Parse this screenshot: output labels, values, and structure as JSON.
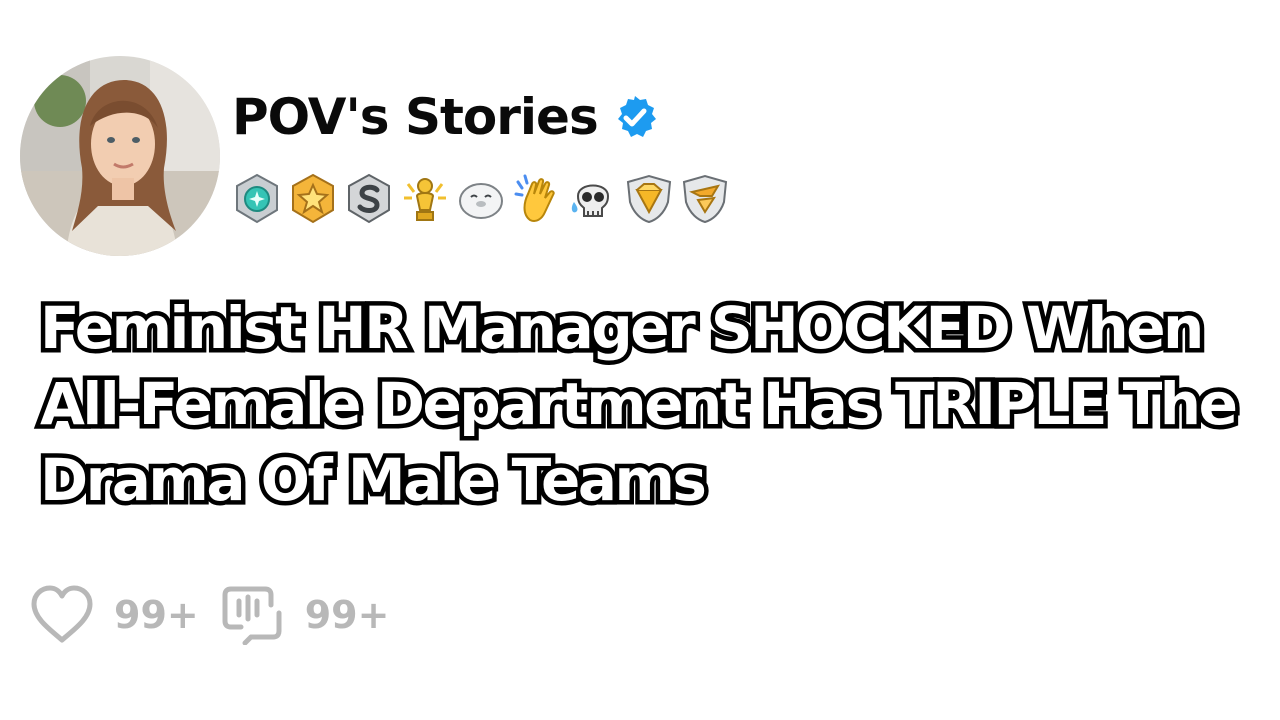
{
  "post": {
    "channel_name": "POV's Stories",
    "verified": true,
    "title": "Feminist HR Manager SHOCKED When All-Female Department Has TRIPLE The Drama Of Male Teams",
    "awards": [
      "teal-medal-icon",
      "gold-star-medal-icon",
      "silver-s-medal-icon",
      "golden-trophy-icon",
      "sleepy-seal-icon",
      "clapping-hands-icon",
      "crying-skull-icon",
      "gold-diamond-shield-icon",
      "silver-winged-shield-icon"
    ],
    "likes": "99+",
    "comments": "99+"
  },
  "colors": {
    "verified_badge": "#1d9bf0",
    "stat_gray": "#b8b8b8",
    "title_fill": "#ffffff",
    "title_stroke": "#000000"
  }
}
